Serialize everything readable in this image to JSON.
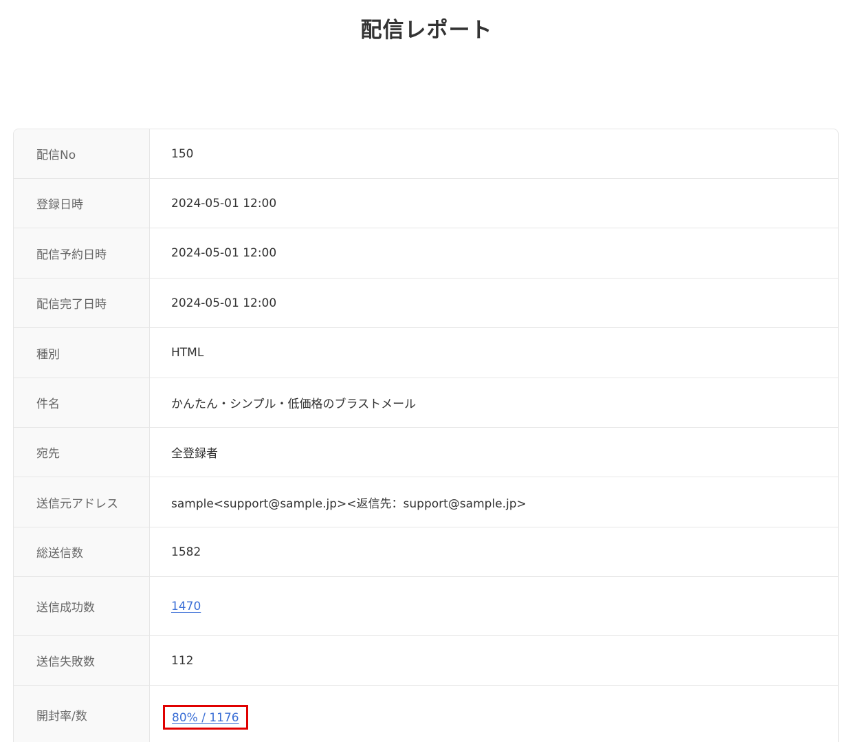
{
  "page": {
    "title": "配信レポート"
  },
  "report": {
    "rows": [
      {
        "label": "配信No",
        "value": "150"
      },
      {
        "label": "登録日時",
        "value": "2024-05-01 12:00"
      },
      {
        "label": "配信予約日時",
        "value": "2024-05-01 12:00"
      },
      {
        "label": "配信完了日時",
        "value": "2024-05-01 12:00"
      },
      {
        "label": "種別",
        "value": "HTML"
      },
      {
        "label": "件名",
        "value": "かんたん・シンプル・低価格のブラストメール"
      },
      {
        "label": "宛先",
        "value": "全登録者"
      },
      {
        "label": "送信元アドレス",
        "value": "sample<support@sample.jp><返信先：support@sample.jp>"
      },
      {
        "label": "総送信数",
        "value": "1582"
      },
      {
        "label": "送信成功数",
        "value": "1470"
      },
      {
        "label": "送信失敗数",
        "value": "112"
      },
      {
        "label": "開封率/数",
        "value": "80% / 1176"
      }
    ]
  },
  "colors": {
    "link": "#3b6fd6",
    "highlight": "#e00000",
    "label_bg": "#f9f9f9",
    "border": "#e6e6e6"
  }
}
